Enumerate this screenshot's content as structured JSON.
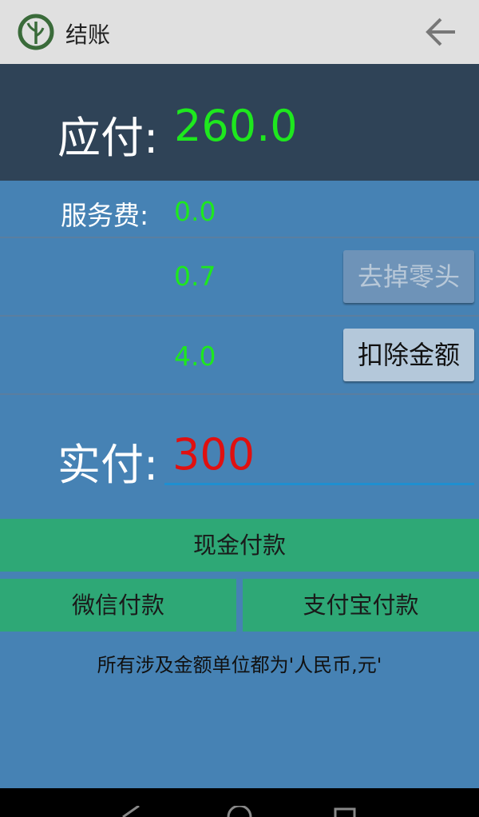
{
  "appbar": {
    "title": "结账",
    "logo_icon": "bamboo-logo-icon",
    "back_icon": "arrow-left-icon"
  },
  "amount_due": {
    "label": "应付:",
    "value": "260.0"
  },
  "service_fee": {
    "label": "服务费:",
    "value": "0.0"
  },
  "remove_change": {
    "value": "0.7",
    "button_label": "去掉零头"
  },
  "deduct": {
    "value": "4.0",
    "button_label": "扣除金额"
  },
  "paid": {
    "label": "实付:",
    "value": "300"
  },
  "payments": {
    "cash": "现金付款",
    "wechat": "微信付款",
    "alipay": "支付宝付款"
  },
  "note": "所有涉及金额单位都为'人民币,元'",
  "colors": {
    "accent_green": "#1ee81e",
    "paid_red": "#e01010",
    "button_green": "#2ea876",
    "background_blue": "#4682b4",
    "header_dark": "#2f4357"
  }
}
